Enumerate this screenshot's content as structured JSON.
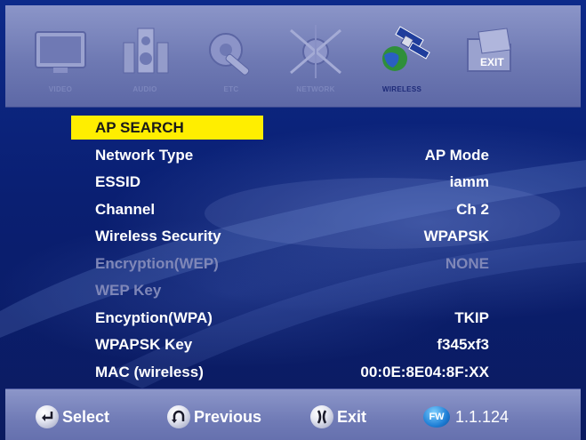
{
  "tabs": [
    {
      "label": "VIDEO",
      "icon": "tv-icon"
    },
    {
      "label": "AUDIO",
      "icon": "speaker-icon"
    },
    {
      "label": "ETC",
      "icon": "wrench-gear-icon"
    },
    {
      "label": "NETWORK",
      "icon": "network-icon"
    },
    {
      "label": "WIRELESS",
      "icon": "satellite-icon",
      "active": true
    },
    {
      "label": "EXIT",
      "icon": "exit-folder-icon"
    }
  ],
  "menu": {
    "items": [
      {
        "label": "AP SEARCH",
        "value": "",
        "state": "highlighted"
      },
      {
        "label": "Network Type",
        "value": "AP Mode",
        "state": "enabled"
      },
      {
        "label": "ESSID",
        "value": "iamm",
        "state": "enabled"
      },
      {
        "label": "Channel",
        "value": "Ch 2",
        "state": "enabled"
      },
      {
        "label": "Wireless Security",
        "value": "WPAPSK",
        "state": "enabled"
      },
      {
        "label": "Encryption(WEP)",
        "value": "NONE",
        "state": "disabled"
      },
      {
        "label": "WEP Key",
        "value": "",
        "state": "disabled"
      },
      {
        "label": "Encyption(WPA)",
        "value": "TKIP",
        "state": "enabled"
      },
      {
        "label": "WPAPSK Key",
        "value": "f345xf3",
        "state": "enabled"
      },
      {
        "label": "MAC (wireless)",
        "value": "00:0E:8E04:8F:XX",
        "state": "enabled"
      }
    ]
  },
  "footer": {
    "select_label": "Select",
    "previous_label": "Previous",
    "exit_label": "Exit",
    "fw_badge": "FW",
    "fw_version": "1.1.124"
  },
  "colors": {
    "highlight": "#ffee00",
    "background": "#0b1c64",
    "bar": "#7c86bd",
    "disabled_text": "#7f87b8"
  }
}
